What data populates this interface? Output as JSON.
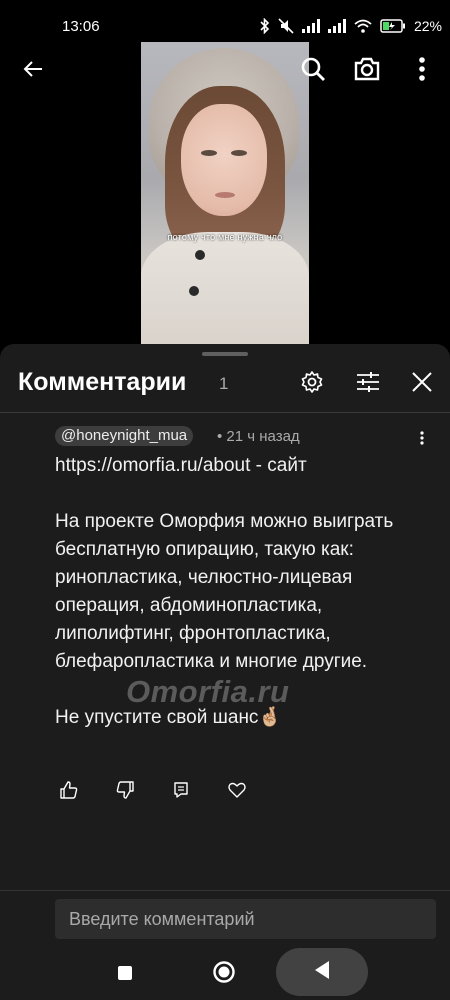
{
  "status_bar": {
    "time": "13:06",
    "battery_percent": "22%",
    "icons": [
      "bluetooth-icon",
      "mute-icon",
      "signal-icon",
      "signal-icon",
      "wifi-icon",
      "battery-icon"
    ]
  },
  "video": {
    "caption": "потому что мне нужна чло"
  },
  "top_actions": {
    "icons": [
      "back-arrow-icon",
      "search-icon",
      "camera-icon",
      "more-vertical-icon"
    ]
  },
  "comments_panel": {
    "title": "Комментарии",
    "count": "1",
    "icons": [
      "settings-gear-icon",
      "filter-sliders-icon",
      "close-icon"
    ]
  },
  "comment": {
    "author": "@honeynight_mua",
    "time": "• 21 ч назад",
    "paragraphs": [
      "https://omorfia.ru/about - сайт",
      "На проекте Оморфия можно выиграть бесплатную опирацию, такую как: ринопластика, челюстно-лицевая операция, абдоминопластика, липолифтинг, фронтопластика, блефаропластика и многие другие.",
      "Не упустите свой шанс🤞🏼"
    ],
    "watermark": "Omorfia.ru",
    "action_icons": [
      "thumbs-up-icon",
      "thumbs-down-icon",
      "reply-icon",
      "heart-icon"
    ]
  },
  "input": {
    "placeholder": "Введите комментарий"
  },
  "nav_bar": {
    "icons": [
      "recents-square-icon",
      "home-circle-icon",
      "back-triangle-icon"
    ]
  },
  "colors": {
    "panel_bg": "#1c1c1c",
    "chip_bg": "#3d3d3d",
    "input_bg": "#2d2d2d",
    "divider": "#3a3a3a"
  }
}
